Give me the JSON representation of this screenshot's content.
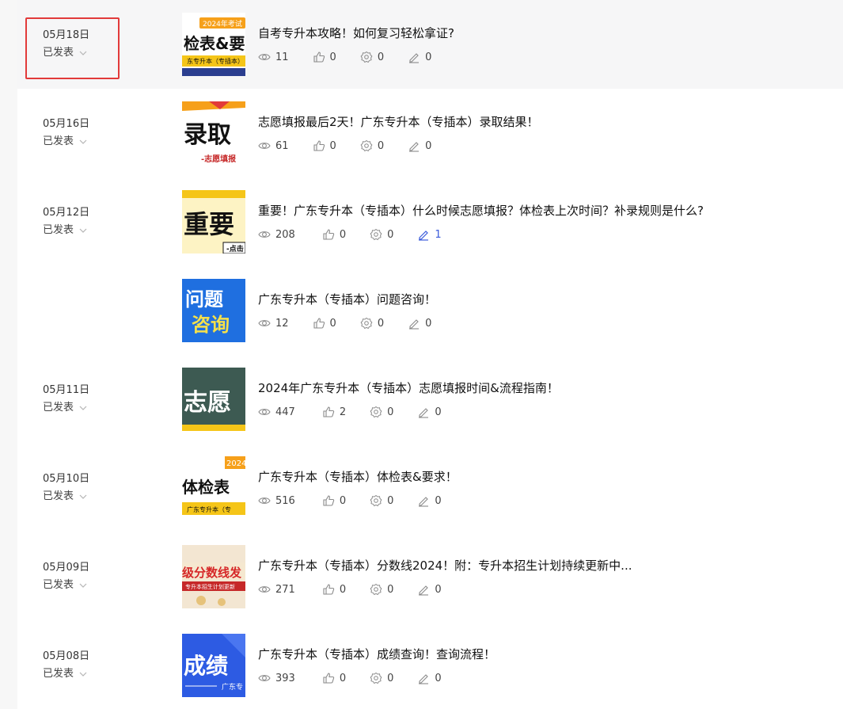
{
  "posts": [
    {
      "date": "05月18日",
      "status": "已发表",
      "title": "自考专升本攻略！如何复习轻松拿证?",
      "views": "11",
      "likes": "0",
      "shares": "0",
      "comments": "0",
      "thumb_text": "检表&要",
      "thumb_top": "2024年考试",
      "thumb_bottom": "东专升本（专插本）"
    },
    {
      "date": "05月16日",
      "status": "已发表",
      "title": "志愿填报最后2天！广东专升本（专插本）录取结果！",
      "views": "61",
      "likes": "0",
      "shares": "0",
      "comments": "0",
      "thumb_text": "录取",
      "thumb_bottom": "-志愿填报"
    },
    {
      "date": "05月12日",
      "status": "已发表",
      "title": "重要！广东专升本（专插本）什么时候志愿填报？体检表上次时间？补录规则是什么?",
      "views": "208",
      "likes": "0",
      "shares": "0",
      "comments": "1",
      "thumb_text": "重要",
      "thumb_bottom": "-点击"
    },
    {
      "date": "",
      "status": "",
      "title": "广东专升本（专插本）问题咨询！",
      "views": "12",
      "likes": "0",
      "shares": "0",
      "comments": "0",
      "thumb_text": "问题",
      "thumb_text2": "咨询"
    },
    {
      "date": "05月11日",
      "status": "已发表",
      "title": "2024年广东专升本（专插本）志愿填报时间&流程指南！",
      "views": "447",
      "likes": "2",
      "shares": "0",
      "comments": "0",
      "thumb_text": "志愿"
    },
    {
      "date": "05月10日",
      "status": "已发表",
      "title": "广东专升本（专插本）体检表&要求！",
      "views": "516",
      "likes": "0",
      "shares": "0",
      "comments": "0",
      "thumb_text": "体检表",
      "thumb_top": "2024",
      "thumb_bottom": "广东专升本（专"
    },
    {
      "date": "05月09日",
      "status": "已发表",
      "title": "广东专升本（专插本）分数线2024！附：专升本招生计划持续更新中...",
      "views": "271",
      "likes": "0",
      "shares": "0",
      "comments": "0",
      "thumb_text": "级分数线发",
      "thumb_bottom": "专升本招生计划更新"
    },
    {
      "date": "05月08日",
      "status": "已发表",
      "title": "广东专升本（专插本）成绩查询！查询流程！",
      "views": "393",
      "likes": "0",
      "shares": "0",
      "comments": "0",
      "thumb_text": "成绩",
      "thumb_bottom": "广东专"
    }
  ],
  "icons": {
    "views": "eye-icon",
    "likes": "thumbs-up-icon",
    "shares": "gear-share-icon",
    "comments": "pencil-icon",
    "status": "chevron-down-icon"
  },
  "colors": {
    "highlight_border": "#e23a3a",
    "active_comment": "#3b5bdb",
    "hover_row": "#f6f6f7"
  }
}
